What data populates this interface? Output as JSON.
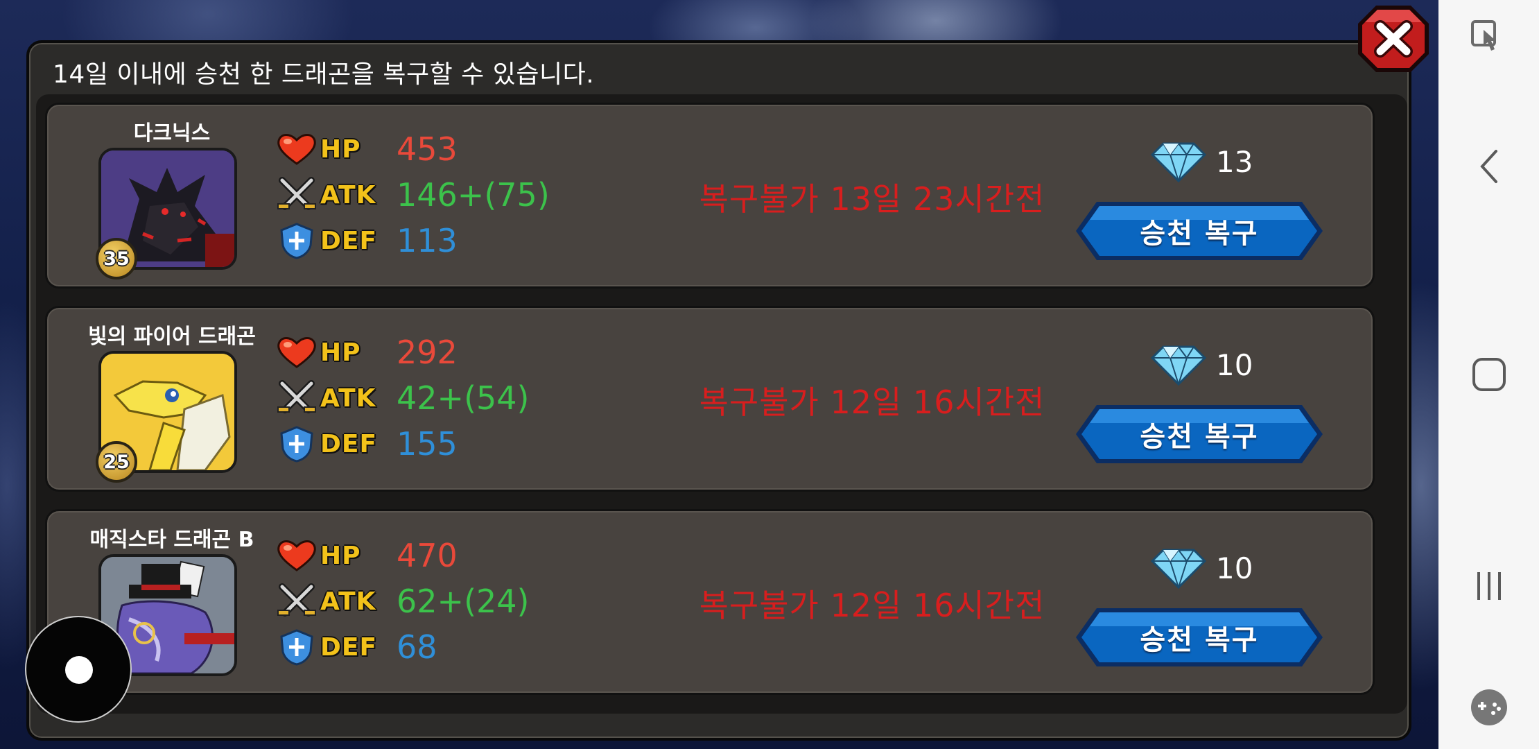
{
  "dialog": {
    "header": "14일 이내에 승천 한 드래곤을 복구할 수 있습니다.",
    "close_icon": "close-x-icon"
  },
  "stat_labels": {
    "hp": "HP",
    "atk": "ATK",
    "def": "DEF"
  },
  "dragons": [
    {
      "name": "다크닉스",
      "level": "35",
      "portrait": "dark-dragon-portrait",
      "hp": "453",
      "atk": "146+(75)",
      "def": "113",
      "restore_status": "복구불가 13일 23시간전",
      "cost": "13",
      "button_label": "승천 복구"
    },
    {
      "name": "빛의 파이어 드래곤",
      "level": "25",
      "portrait": "yellow-dragon-portrait",
      "hp": "292",
      "atk": "42+(54)",
      "def": "155",
      "restore_status": "복구불가 12일 16시간전",
      "cost": "10",
      "button_label": "승천 복구"
    },
    {
      "name": "매직스타 드래곤 B",
      "level": "",
      "portrait": "magic-star-dragon-portrait",
      "hp": "470",
      "atk": "62+(24)",
      "def": "68",
      "restore_status": "복구불가 12일 16시간전",
      "cost": "10",
      "button_label": "승천 복구"
    }
  ],
  "colors": {
    "hp": "#e9493a",
    "atk": "#3cc24b",
    "def": "#2f8fd8",
    "status": "#d81e1e",
    "button": "#0a63b8",
    "stat_label": "#f3c21a"
  },
  "system_nav": {
    "items": [
      "screen-touch-lock-icon",
      "back-icon",
      "home-icon",
      "recent-apps-icon",
      "game-tools-icon"
    ]
  }
}
